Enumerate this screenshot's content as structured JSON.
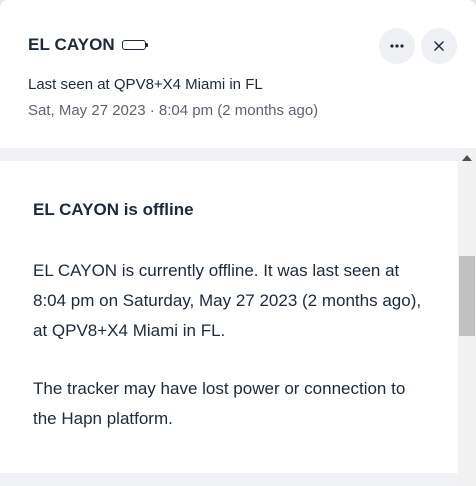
{
  "header": {
    "device_name": "EL CAYON",
    "battery_icon": "battery-empty-icon",
    "last_seen_location": "Last seen at QPV8+X4 Miami in FL",
    "last_seen_time": "Sat, May 27 2023 · 8:04 pm (2 months ago)",
    "more_icon": "more-horizontal-icon",
    "close_icon": "close-icon"
  },
  "content": {
    "status_heading": "EL CAYON is offline",
    "paragraph_1": "EL CAYON is currently offline. It was last seen at 8:04 pm on Saturday, May 27 2023 (2 months ago), at QPV8+X4 Miami in FL.",
    "paragraph_2": "The tracker may have lost power or connection to the Hapn platform."
  },
  "colors": {
    "text_primary": "#1c2a3a",
    "text_secondary": "#5b6470",
    "button_bg": "#eef0f4",
    "band_bg": "#f0f2f6"
  }
}
